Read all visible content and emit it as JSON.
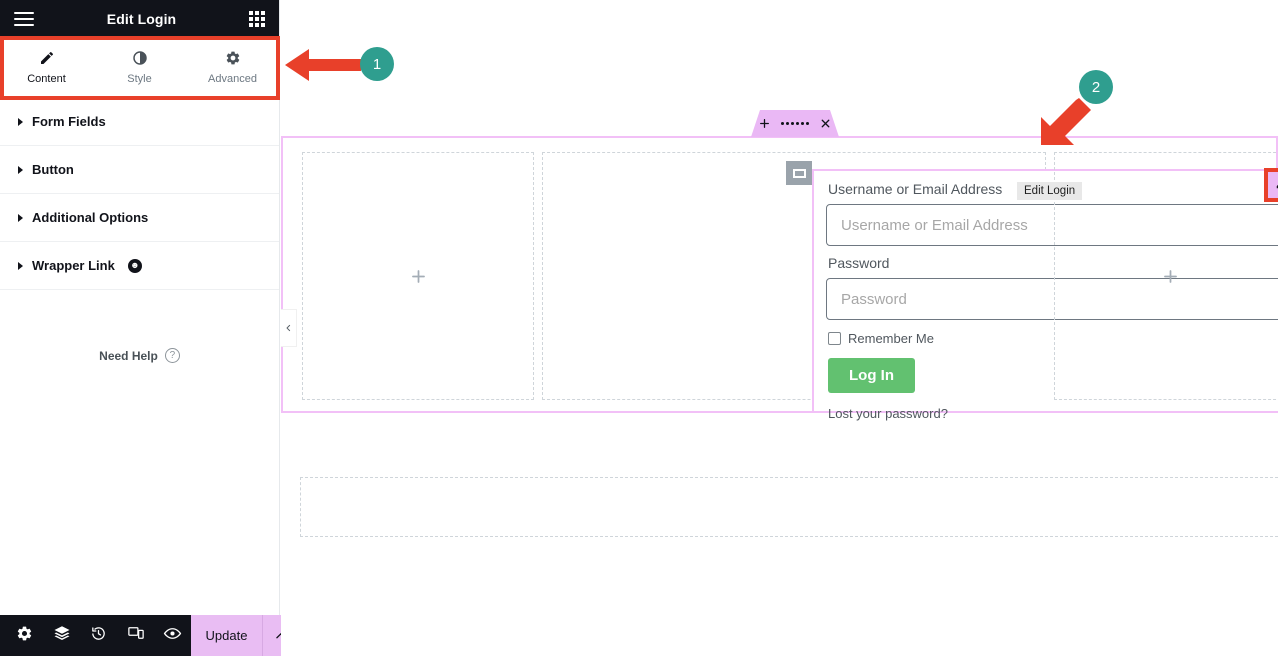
{
  "panel": {
    "header": {
      "menu_icon": "hamburger-icon",
      "title": "Edit Login",
      "widgets_icon": "grid-icon"
    },
    "tabs": [
      {
        "label": "Content",
        "icon": "pencil-icon",
        "active": true
      },
      {
        "label": "Style",
        "icon": "contrast-icon",
        "active": false
      },
      {
        "label": "Advanced",
        "icon": "gear-icon",
        "active": false
      }
    ],
    "sections": [
      {
        "label": "Form Fields",
        "pro": false
      },
      {
        "label": "Button",
        "pro": false
      },
      {
        "label": "Additional Options",
        "pro": false
      },
      {
        "label": "Wrapper Link",
        "pro": true
      }
    ],
    "need_help": {
      "label": "Need Help",
      "icon": "question-circle-icon"
    },
    "footer": {
      "tools": [
        {
          "icon": "gear-icon",
          "name": "settings"
        },
        {
          "icon": "layers-icon",
          "name": "navigator"
        },
        {
          "icon": "history-icon",
          "name": "history"
        },
        {
          "icon": "responsive-icon",
          "name": "responsive-mode"
        },
        {
          "icon": "eye-icon",
          "name": "preview"
        }
      ],
      "update_label": "Update",
      "update_caret_icon": "chevron-up-icon",
      "update_color": "#e9bdf3"
    }
  },
  "canvas": {
    "collapse_icon": "chevron-left-icon",
    "section_tab": {
      "add_icon": "plus-icon",
      "drag_icon": "drag-dots-icon",
      "close_icon": "close-icon",
      "color": "#eab8f5"
    },
    "columns": {
      "left_add_icon": "plus-icon",
      "right_add_icon": "plus-icon"
    },
    "widget": {
      "handle_icon": "column-handle-icon",
      "edit_icon": "pencil-icon",
      "edit_color": "#eab8f5",
      "tooltip": "Edit Login",
      "form": {
        "username_label": "Username or Email Address",
        "username_placeholder": "Username or Email Address",
        "username_value": "",
        "password_label": "Password",
        "password_placeholder": "Password",
        "password_value": "",
        "remember_label": "Remember Me",
        "remember_checked": false,
        "submit_label": "Log In",
        "submit_color": "#62c170",
        "lost_password_label": "Lost your password?"
      }
    }
  },
  "annotations": [
    {
      "number": "1",
      "target": "panel-tabs",
      "arrow": "left",
      "color": "#2f9e8f",
      "arrow_color": "#e8402a"
    },
    {
      "number": "2",
      "target": "widget-edit-button",
      "arrow": "down-left",
      "color": "#2f9e8f",
      "arrow_color": "#e8402a"
    }
  ]
}
